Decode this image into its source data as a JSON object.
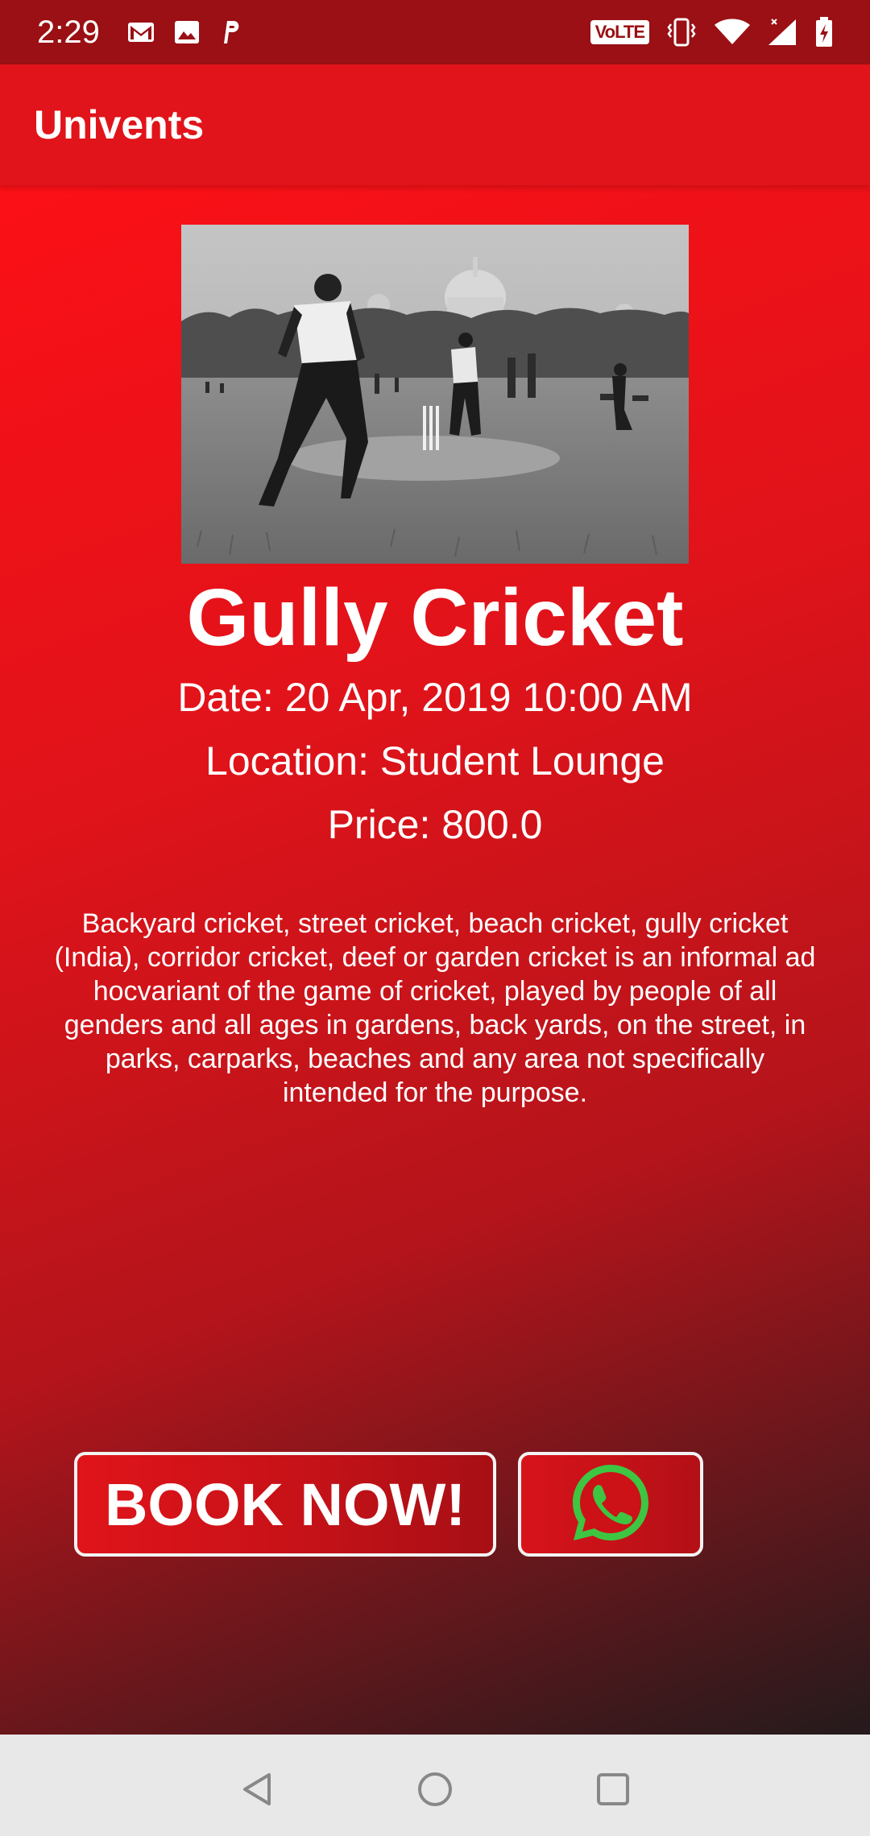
{
  "status_bar": {
    "time": "2:29",
    "left_icons": [
      "gmail-icon",
      "image-icon",
      "p-app-icon"
    ],
    "volte_label": "VoLTE",
    "right_icons": [
      "vibrate-icon",
      "wifi-icon",
      "signal-icon",
      "battery-charging-icon"
    ]
  },
  "app_bar": {
    "title": "Univents"
  },
  "event": {
    "title": "Gully Cricket",
    "date": "Date: 20 Apr, 2019 10:00 AM",
    "location": "Location: Student Lounge",
    "price": "Price: 800.0",
    "description": "Backyard cricket, street cricket, beach cricket, gully cricket (India), corridor cricket, deef or garden cricket is an informal ad hocvariant of the game of cricket, played by people of all genders and all ages in gardens, back yards, on the street, in parks, carparks, beaches and any area not specifically intended for the purpose."
  },
  "actions": {
    "book_label": "BOOK NOW!",
    "share_icon": "whatsapp-icon"
  },
  "nav_bar": {
    "buttons": [
      "back-icon",
      "home-icon",
      "recents-icon"
    ]
  },
  "colors": {
    "status_bar": "#9a1014",
    "app_bar": "#e0141a",
    "gradient_top": "#fb1016",
    "gradient_bottom": "#241a1c",
    "whatsapp_green": "#3ec542",
    "nav_bar": "#e8e8e8"
  }
}
